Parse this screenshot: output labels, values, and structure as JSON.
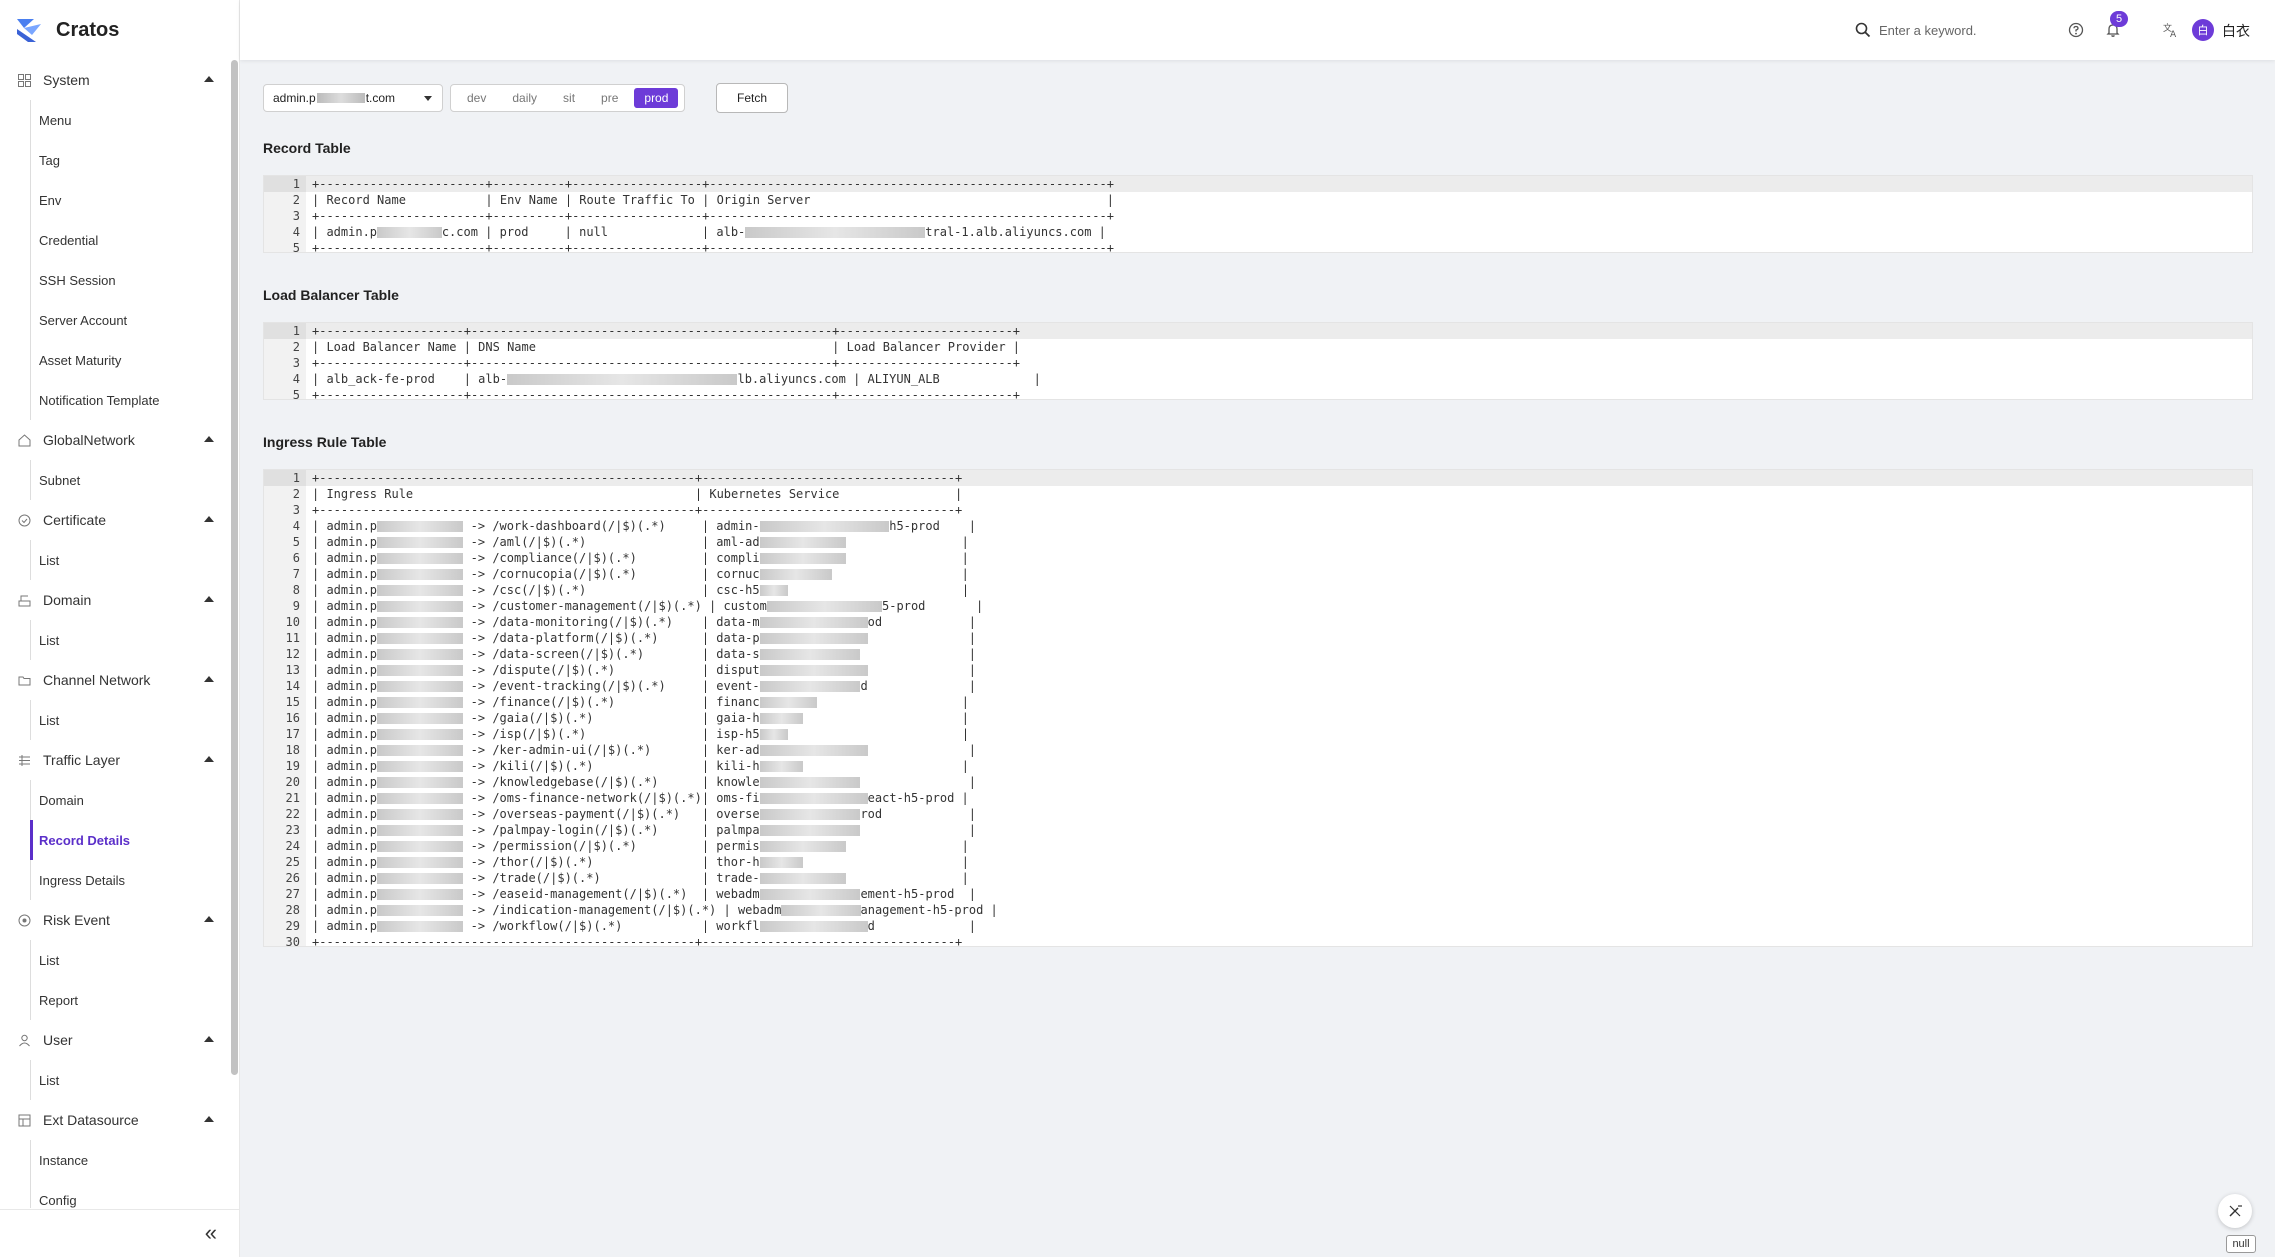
{
  "app": {
    "name": "Cratos"
  },
  "colors": {
    "accent": "#6d3bd8",
    "active_text": "#5b2fc9"
  },
  "sidebar": {
    "groups": [
      {
        "label": "System",
        "icon": "grid-icon",
        "items": [
          "Menu",
          "Tag",
          "Env",
          "Credential",
          "SSH Session",
          "Server Account",
          "Asset Maturity",
          "Notification Template"
        ]
      },
      {
        "label": "GlobalNetwork",
        "icon": "home-icon",
        "items": [
          "Subnet"
        ]
      },
      {
        "label": "Certificate",
        "icon": "shield-icon",
        "items": [
          "List"
        ]
      },
      {
        "label": "Domain",
        "icon": "domain-icon",
        "items": [
          "List"
        ]
      },
      {
        "label": "Channel Network",
        "icon": "folder-icon",
        "items": [
          "List"
        ]
      },
      {
        "label": "Traffic Layer",
        "icon": "layers-icon",
        "items": [
          "Domain",
          "Record Details",
          "Ingress Details"
        ]
      },
      {
        "label": "Risk Event",
        "icon": "risk-icon",
        "items": [
          "List",
          "Report"
        ]
      },
      {
        "label": "User",
        "icon": "user-icon",
        "items": [
          "List"
        ]
      },
      {
        "label": "Ext Datasource",
        "icon": "datasource-icon",
        "items": [
          "Instance",
          "Config"
        ]
      }
    ],
    "active_item": "Record Details",
    "collapse_label": "«"
  },
  "header": {
    "search_placeholder": "Enter a keyword.",
    "notification_count": "5",
    "avatar_initial": "白",
    "username": "白衣"
  },
  "toolbar": {
    "domain_prefix": "admin.p",
    "domain_suffix": "t.com",
    "envs": [
      "dev",
      "daily",
      "sit",
      "pre",
      "prod"
    ],
    "active_env": "prod",
    "fetch_label": "Fetch"
  },
  "record_table": {
    "title": "Record Table",
    "lines": [
      "+-----------------------+----------+------------------+-------------------------------------------------------+",
      "| Record Name           | Env Name | Route Traffic To | Origin Server                                         |",
      "+-----------------------+----------+------------------+-------------------------------------------------------+",
      "| admin.p▒▒▒▒▒▒▒▒▒c.com | prod     | null             | alb-▒▒▒▒▒▒▒▒▒▒▒▒▒▒▒▒▒▒▒▒▒▒▒▒▒tral-1.alb.aliyuncs.com |",
      "+-----------------------+----------+------------------+-------------------------------------------------------+"
    ]
  },
  "lb_table": {
    "title": "Load Balancer Table",
    "lines": [
      "+--------------------+--------------------------------------------------+------------------------+",
      "| Load Balancer Name | DNS Name                                         | Load Balancer Provider |",
      "+--------------------+--------------------------------------------------+------------------------+",
      "| alb_ack-fe-prod    | alb-▒▒▒▒▒▒▒▒▒▒▒▒▒▒▒▒▒▒▒▒▒▒▒▒▒▒▒▒▒▒▒▒lb.aliyuncs.com | ALIYUN_ALB             |",
      "+--------------------+--------------------------------------------------+------------------------+"
    ]
  },
  "ingress_table": {
    "title": "Ingress Rule Table",
    "lines": [
      "+----------------------------------------------------+-----------------------------------+",
      "| Ingress Rule                                       | Kubernetes Service                |",
      "+----------------------------------------------------+-----------------------------------+",
      "| admin.p▒▒▒▒▒▒▒▒▒▒▒▒ -> /work-dashboard(/|$)(.*)     | admin-▒▒▒▒▒▒▒▒▒▒▒▒▒▒▒▒▒▒h5-prod    |",
      "| admin.p▒▒▒▒▒▒▒▒▒▒▒▒ -> /aml(/|$)(.*)                | aml-ad▒▒▒▒▒▒▒▒▒▒▒▒                |",
      "| admin.p▒▒▒▒▒▒▒▒▒▒▒▒ -> /compliance(/|$)(.*)         | compli▒▒▒▒▒▒▒▒▒▒▒▒                |",
      "| admin.p▒▒▒▒▒▒▒▒▒▒▒▒ -> /cornucopia(/|$)(.*)         | cornuc▒▒▒▒▒▒▒▒▒▒                  |",
      "| admin.p▒▒▒▒▒▒▒▒▒▒▒▒ -> /csc(/|$)(.*)                | csc-h5▒▒▒▒                        |",
      "| admin.p▒▒▒▒▒▒▒▒▒▒▒▒ -> /customer-management(/|$)(.*) | custom▒▒▒▒▒▒▒▒▒▒▒▒▒▒▒▒5-prod       |",
      "| admin.p▒▒▒▒▒▒▒▒▒▒▒▒ -> /data-monitoring(/|$)(.*)    | data-m▒▒▒▒▒▒▒▒▒▒▒▒▒▒▒od            |",
      "| admin.p▒▒▒▒▒▒▒▒▒▒▒▒ -> /data-platform(/|$)(.*)      | data-p▒▒▒▒▒▒▒▒▒▒▒▒▒▒▒              |",
      "| admin.p▒▒▒▒▒▒▒▒▒▒▒▒ -> /data-screen(/|$)(.*)        | data-s▒▒▒▒▒▒▒▒▒▒▒▒▒▒               |",
      "| admin.p▒▒▒▒▒▒▒▒▒▒▒▒ -> /dispute(/|$)(.*)            | disput▒▒▒▒▒▒▒▒▒▒▒▒▒▒▒              |",
      "| admin.p▒▒▒▒▒▒▒▒▒▒▒▒ -> /event-tracking(/|$)(.*)     | event-▒▒▒▒▒▒▒▒▒▒▒▒▒▒d              |",
      "| admin.p▒▒▒▒▒▒▒▒▒▒▒▒ -> /finance(/|$)(.*)            | financ▒▒▒▒▒▒▒▒                    |",
      "| admin.p▒▒▒▒▒▒▒▒▒▒▒▒ -> /gaia(/|$)(.*)               | gaia-h▒▒▒▒▒▒                      |",
      "| admin.p▒▒▒▒▒▒▒▒▒▒▒▒ -> /isp(/|$)(.*)                | isp-h5▒▒▒▒                        |",
      "| admin.p▒▒▒▒▒▒▒▒▒▒▒▒ -> /ker-admin-ui(/|$)(.*)       | ker-ad▒▒▒▒▒▒▒▒▒▒▒▒▒▒▒              |",
      "| admin.p▒▒▒▒▒▒▒▒▒▒▒▒ -> /kili(/|$)(.*)               | kili-h▒▒▒▒▒▒                      |",
      "| admin.p▒▒▒▒▒▒▒▒▒▒▒▒ -> /knowledgebase(/|$)(.*)      | knowle▒▒▒▒▒▒▒▒▒▒▒▒▒▒               |",
      "| admin.p▒▒▒▒▒▒▒▒▒▒▒▒ -> /oms-finance-network(/|$)(.*)| oms-fi▒▒▒▒▒▒▒▒▒▒▒▒▒▒▒eact-h5-prod |",
      "| admin.p▒▒▒▒▒▒▒▒▒▒▒▒ -> /overseas-payment(/|$)(.*)   | overse▒▒▒▒▒▒▒▒▒▒▒▒▒▒rod            |",
      "| admin.p▒▒▒▒▒▒▒▒▒▒▒▒ -> /palmpay-login(/|$)(.*)      | palmpa▒▒▒▒▒▒▒▒▒▒▒▒▒▒               |",
      "| admin.p▒▒▒▒▒▒▒▒▒▒▒▒ -> /permission(/|$)(.*)         | permis▒▒▒▒▒▒▒▒▒▒▒▒                |",
      "| admin.p▒▒▒▒▒▒▒▒▒▒▒▒ -> /thor(/|$)(.*)               | thor-h▒▒▒▒▒▒                      |",
      "| admin.p▒▒▒▒▒▒▒▒▒▒▒▒ -> /trade(/|$)(.*)              | trade-▒▒▒▒▒▒▒▒▒▒▒▒                |",
      "| admin.p▒▒▒▒▒▒▒▒▒▒▒▒ -> /easeid-management(/|$)(.*)  | webadm▒▒▒▒▒▒▒▒▒▒▒▒▒▒ement-h5-prod  |",
      "| admin.p▒▒▒▒▒▒▒▒▒▒▒▒ -> /indication-management(/|$)(.*) | webadm▒▒▒▒▒▒▒▒▒▒▒anagement-h5-prod |",
      "| admin.p▒▒▒▒▒▒▒▒▒▒▒▒ -> /workflow(/|$)(.*)           | workfl▒▒▒▒▒▒▒▒▒▒▒▒▒▒▒d             |",
      "+----------------------------------------------------+-----------------------------------+"
    ]
  },
  "footer": {
    "null_label": "null"
  }
}
